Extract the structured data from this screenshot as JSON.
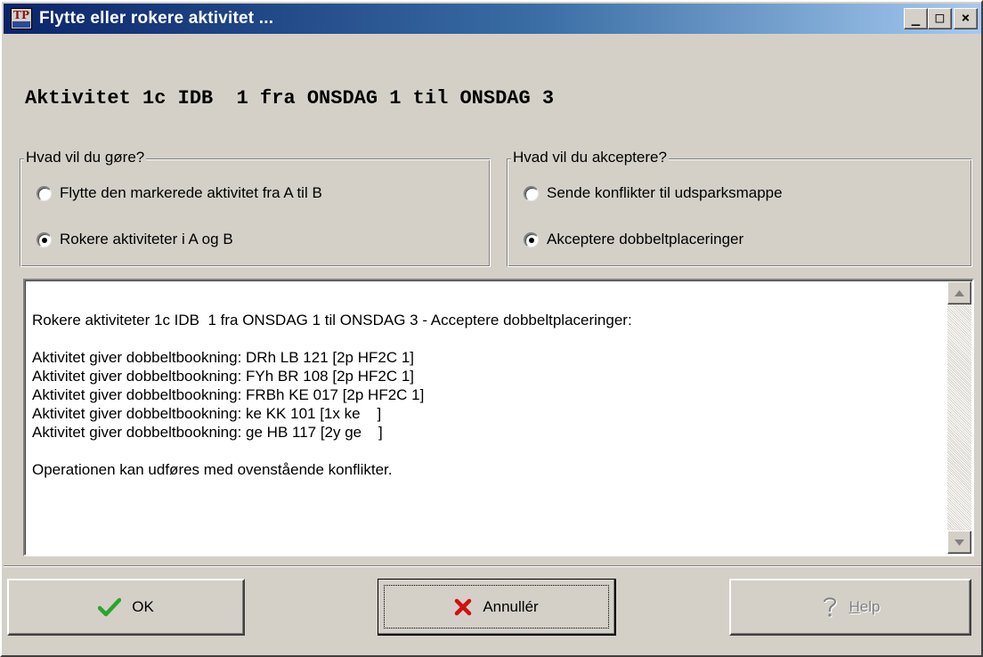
{
  "window": {
    "title": "Flytte eller rokere aktivitet ...",
    "app_icon_text": "TP",
    "minimize_label": "_",
    "maximize_label": "□",
    "close_label": "×"
  },
  "headline": "Aktivitet 1c IDB  1 fra ONSDAG 1 til ONSDAG 3",
  "group_action": {
    "legend": "Hvad vil du gøre?",
    "options": [
      {
        "label": "Flytte den markerede aktivitet fra A til B",
        "checked": false
      },
      {
        "label": "Rokere aktiviteter i A og B",
        "checked": true
      }
    ]
  },
  "group_accept": {
    "legend": "Hvad vil du akceptere?",
    "options": [
      {
        "label": "Sende konflikter til udsparksmappe",
        "checked": false
      },
      {
        "label": "Akceptere dobbeltplaceringer",
        "checked": true
      }
    ]
  },
  "message": {
    "summary": "Rokere aktiviteter 1c IDB  1 fra ONSDAG 1 til ONSDAG 3 - Acceptere dobbeltplaceringer:",
    "lines": [
      "Aktivitet giver dobbeltbookning: DRh LB 121 [2p HF2C 1]",
      "Aktivitet giver dobbeltbookning: FYh BR 108 [2p HF2C 1]",
      "Aktivitet giver dobbeltbookning: FRBh KE 017 [2p HF2C 1]",
      "Aktivitet giver dobbeltbookning: ke KK 101 [1x ke    ]",
      "Aktivitet giver dobbeltbookning: ge HB 117 [2y ge    ]"
    ],
    "footer": "Operationen kan udføres med ovenstående konflikter."
  },
  "buttons": {
    "ok_label": "OK",
    "cancel_label": "Annullér",
    "help_label_mnemonic": "H",
    "help_label_rest": "elp"
  },
  "icons": {
    "ok": "checkmark-icon",
    "cancel": "x-mark-icon",
    "help": "question-icon"
  },
  "colors": {
    "title_gradient_start": "#0a246a",
    "title_gradient_end": "#a6caf0",
    "face": "#d4d0c8",
    "ok_check": "#2aa52a",
    "cancel_x": "#d01010"
  }
}
